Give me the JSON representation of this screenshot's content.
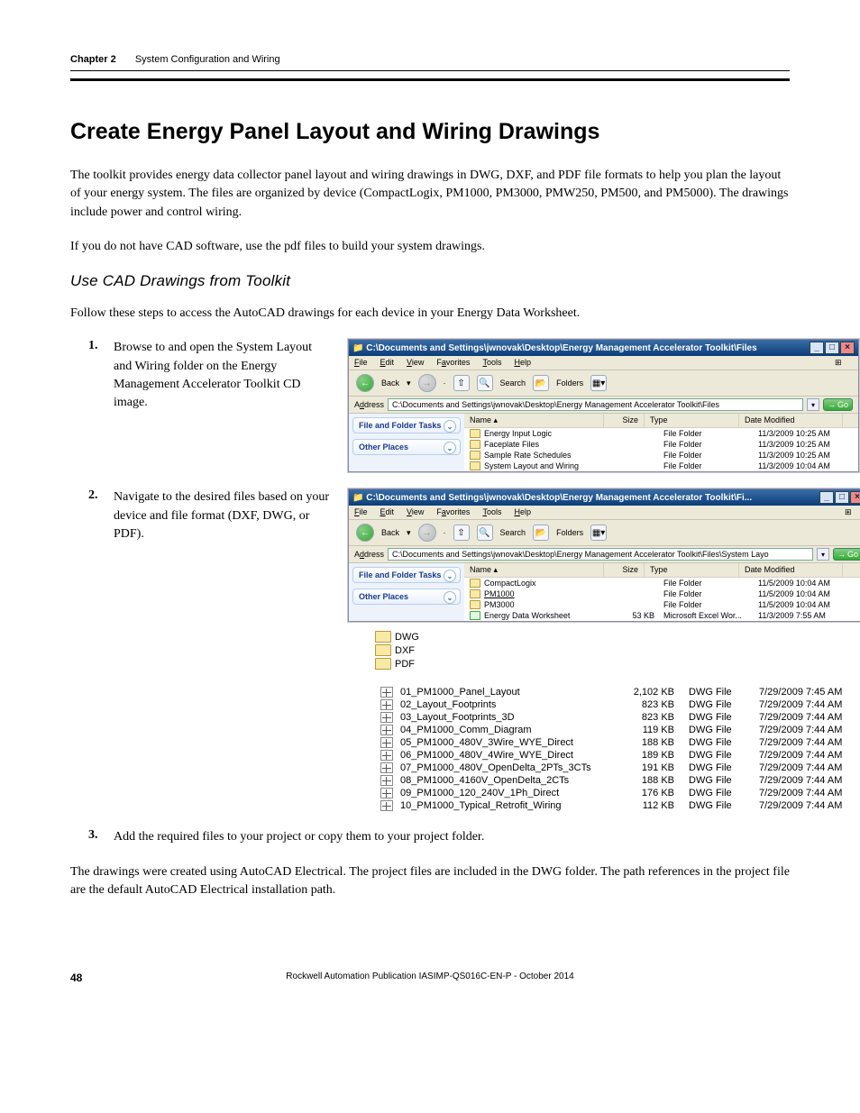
{
  "header": {
    "chapter": "Chapter 2",
    "section": "System Configuration and Wiring"
  },
  "title": "Create Energy Panel Layout and Wiring Drawings",
  "para1": "The toolkit provides energy data collector panel layout and wiring drawings in DWG, DXF, and PDF file formats to help you plan the layout of your energy system. The files are organized by device (CompactLogix, PM1000, PM3000, PMW250, PM500, and PM5000). The drawings include power and control wiring.",
  "para2": "If you do not have CAD software, use the pdf files to build your system drawings.",
  "subhead": "Use CAD Drawings from Toolkit",
  "para3": "Follow these steps to access the AutoCAD drawings for each device in your Energy Data Worksheet.",
  "step1": "Browse to and open the System Layout and Wiring folder on the Energy Management Accelerator Toolkit CD image.",
  "step2": "Navigate to the desired files based on your device and file format (DXF, DWG, or PDF).",
  "step3": "Add the required files to your project or copy them to your project folder.",
  "closing": "The drawings were created using AutoCAD Electrical. The project files are included in the DWG folder. The path references in the project file are the default AutoCAD Electrical installation path.",
  "win1": {
    "title": "C:\\Documents and Settings\\jwnovak\\Desktop\\Energy Management Accelerator Toolkit\\Files",
    "menus": [
      "File",
      "Edit",
      "View",
      "Favorites",
      "Tools",
      "Help"
    ],
    "back": "Back",
    "search": "Search",
    "folders": "Folders",
    "address_label": "Address",
    "address": "C:\\Documents and Settings\\jwnovak\\Desktop\\Energy Management Accelerator Toolkit\\Files",
    "go": "Go",
    "side_tasks": "File and Folder Tasks",
    "side_other": "Other Places",
    "cols": {
      "name": "Name",
      "size": "Size",
      "type": "Type",
      "date": "Date Modified"
    },
    "rows": [
      {
        "name": "Energy Input Logic",
        "size": "",
        "type": "File Folder",
        "date": "11/3/2009 10:25 AM"
      },
      {
        "name": "Faceplate Files",
        "size": "",
        "type": "File Folder",
        "date": "11/3/2009 10:25 AM"
      },
      {
        "name": "Sample Rate Schedules",
        "size": "",
        "type": "File Folder",
        "date": "11/3/2009 10:25 AM"
      },
      {
        "name": "System Layout and Wiring",
        "size": "",
        "type": "File Folder",
        "date": "11/3/2009 10:04 AM"
      }
    ]
  },
  "win2": {
    "title": "C:\\Documents and Settings\\jwnovak\\Desktop\\Energy Management Accelerator Toolkit\\Fi...",
    "address": "C:\\Documents and Settings\\jwnovak\\Desktop\\Energy Management Accelerator Toolkit\\Files\\System Layo",
    "rows": [
      {
        "name": "CompactLogix",
        "size": "",
        "type": "File Folder",
        "date": "11/5/2009 10:04 AM"
      },
      {
        "name": "PM1000",
        "size": "",
        "type": "File Folder",
        "date": "11/5/2009 10:04 AM"
      },
      {
        "name": "PM3000",
        "size": "",
        "type": "File Folder",
        "date": "11/5/2009 10:04 AM"
      },
      {
        "name": "Energy Data Worksheet",
        "size": "53 KB",
        "type": "Microsoft Excel Wor...",
        "date": "11/3/2009 7:55 AM",
        "xls": true
      }
    ]
  },
  "subfolders": [
    "DWG",
    "DXF",
    "PDF"
  ],
  "dwg_files": [
    {
      "name": "01_PM1000_Panel_Layout",
      "size": "2,102 KB",
      "type": "DWG File",
      "date": "7/29/2009 7:45 AM"
    },
    {
      "name": "02_Layout_Footprints",
      "size": "823 KB",
      "type": "DWG File",
      "date": "7/29/2009 7:44 AM"
    },
    {
      "name": "03_Layout_Footprints_3D",
      "size": "823 KB",
      "type": "DWG File",
      "date": "7/29/2009 7:44 AM"
    },
    {
      "name": "04_PM1000_Comm_Diagram",
      "size": "119 KB",
      "type": "DWG File",
      "date": "7/29/2009 7:44 AM"
    },
    {
      "name": "05_PM1000_480V_3Wire_WYE_Direct",
      "size": "188 KB",
      "type": "DWG File",
      "date": "7/29/2009 7:44 AM"
    },
    {
      "name": "06_PM1000_480V_4Wire_WYE_Direct",
      "size": "189 KB",
      "type": "DWG File",
      "date": "7/29/2009 7:44 AM"
    },
    {
      "name": "07_PM1000_480V_OpenDelta_2PTs_3CTs",
      "size": "191 KB",
      "type": "DWG File",
      "date": "7/29/2009 7:44 AM"
    },
    {
      "name": "08_PM1000_4160V_OpenDelta_2CTs",
      "size": "188 KB",
      "type": "DWG File",
      "date": "7/29/2009 7:44 AM"
    },
    {
      "name": "09_PM1000_120_240V_1Ph_Direct",
      "size": "176 KB",
      "type": "DWG File",
      "date": "7/29/2009 7:44 AM"
    },
    {
      "name": "10_PM1000_Typical_Retrofit_Wiring",
      "size": "112 KB",
      "type": "DWG File",
      "date": "7/29/2009 7:44 AM"
    }
  ],
  "footer": {
    "page": "48",
    "pub": "Rockwell Automation Publication IASIMP-QS016C-EN-P - October 2014"
  }
}
